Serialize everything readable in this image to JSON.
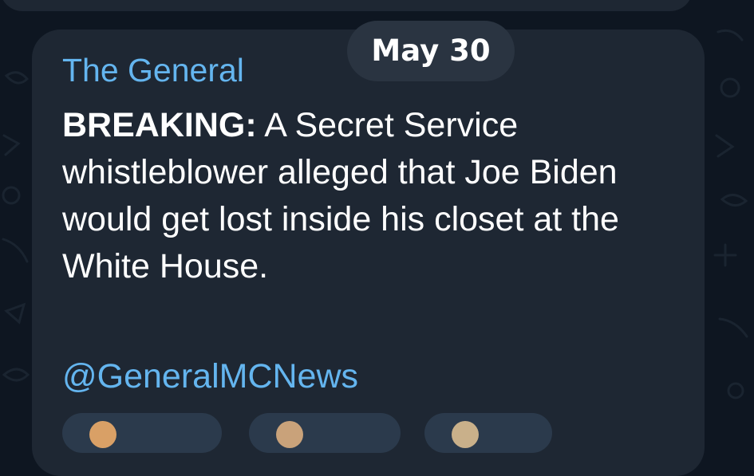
{
  "chat": {
    "date_badge": "May 30",
    "message": {
      "sender": "The General",
      "lead": "BREAKING:",
      "body": " A Secret Service whistleblower alleged that Joe Biden would get lost inside his closet at the White House.",
      "link": "@GeneralMCNews"
    },
    "reactions": [
      {
        "icon": "emoji-face-icon",
        "color": "#d9a066"
      },
      {
        "icon": "emoji-face-icon",
        "color": "#c9a27a"
      },
      {
        "icon": "emoji-icon",
        "color": "#c9b08a"
      }
    ]
  },
  "colors": {
    "background": "#0e1621",
    "bubble": "#1e2733",
    "date_pill": "#2a3441",
    "accent_blue": "#64b5ef",
    "text": "#ffffff"
  }
}
